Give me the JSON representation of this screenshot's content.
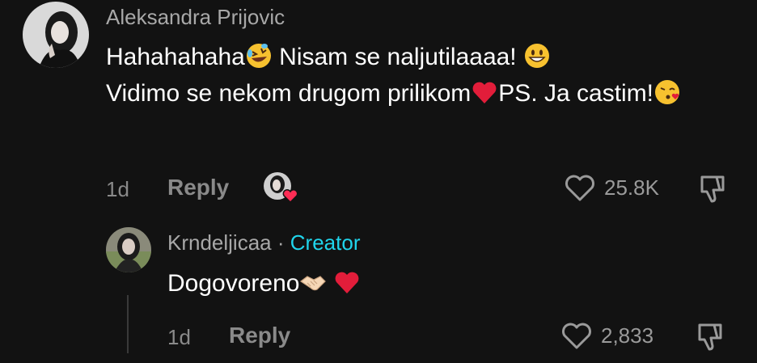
{
  "comment": {
    "username": "Aleksandra Prijovic",
    "text_part1": "Hahahahaha",
    "text_part2": " Nisam se naljutilaaaa! ",
    "text_part3": "Vidimo se nekom drugom prilikom",
    "text_part4": "PS. Ja castim!",
    "time": "1d",
    "reply_label": "Reply",
    "likes": "25.8K"
  },
  "reply": {
    "username": "Krndeljicaa",
    "separator": "·",
    "badge": "Creator",
    "text": "Dogovoreno",
    "time": "1d",
    "reply_label": "Reply",
    "likes": "2,833"
  },
  "icons": {
    "like": "heart-outline-icon",
    "dislike": "thumbs-down-icon",
    "creator_liked": "creator-liked-heart-icon"
  },
  "colors": {
    "background": "#121212",
    "text": "#ffffff",
    "muted": "#8a8a8a",
    "creator": "#20d5ec",
    "heart": "#e21d3a"
  }
}
